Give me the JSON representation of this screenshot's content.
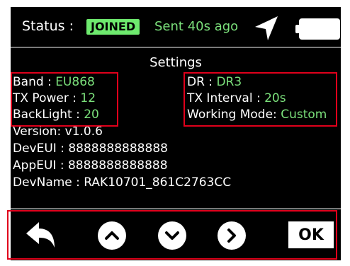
{
  "status": {
    "label": "Status :",
    "state": "JOINED",
    "sent": "Sent 40s ago",
    "icons": [
      "navigation-arrow-icon",
      "battery-icon"
    ]
  },
  "settings": {
    "title": "Settings",
    "left": [
      {
        "label": "Band : ",
        "value": "EU868"
      },
      {
        "label": "TX Power : ",
        "value": "12"
      },
      {
        "label": "BackLight : ",
        "value": "20"
      }
    ],
    "right": [
      {
        "label": "DR : ",
        "value": "DR3"
      },
      {
        "label": "TX Interval : ",
        "value": "20s"
      },
      {
        "label": "Working Mode: ",
        "value": "Custom"
      }
    ],
    "info": [
      "Version: v1.0.6",
      "DevEUI : 8888888888888",
      "AppEUI : 8888888888888",
      "DevName : RAK10701_861C2763CC"
    ]
  },
  "buttons": {
    "back": "back-arrow-icon",
    "up": "chevron-up-icon",
    "down": "chevron-down-icon",
    "next": "chevron-right-icon",
    "ok": "OK"
  },
  "colors": {
    "background": "#000000",
    "accent_green": "#7be07b",
    "badge_green": "#6eea6e",
    "highlight_red": "#e0001b"
  }
}
